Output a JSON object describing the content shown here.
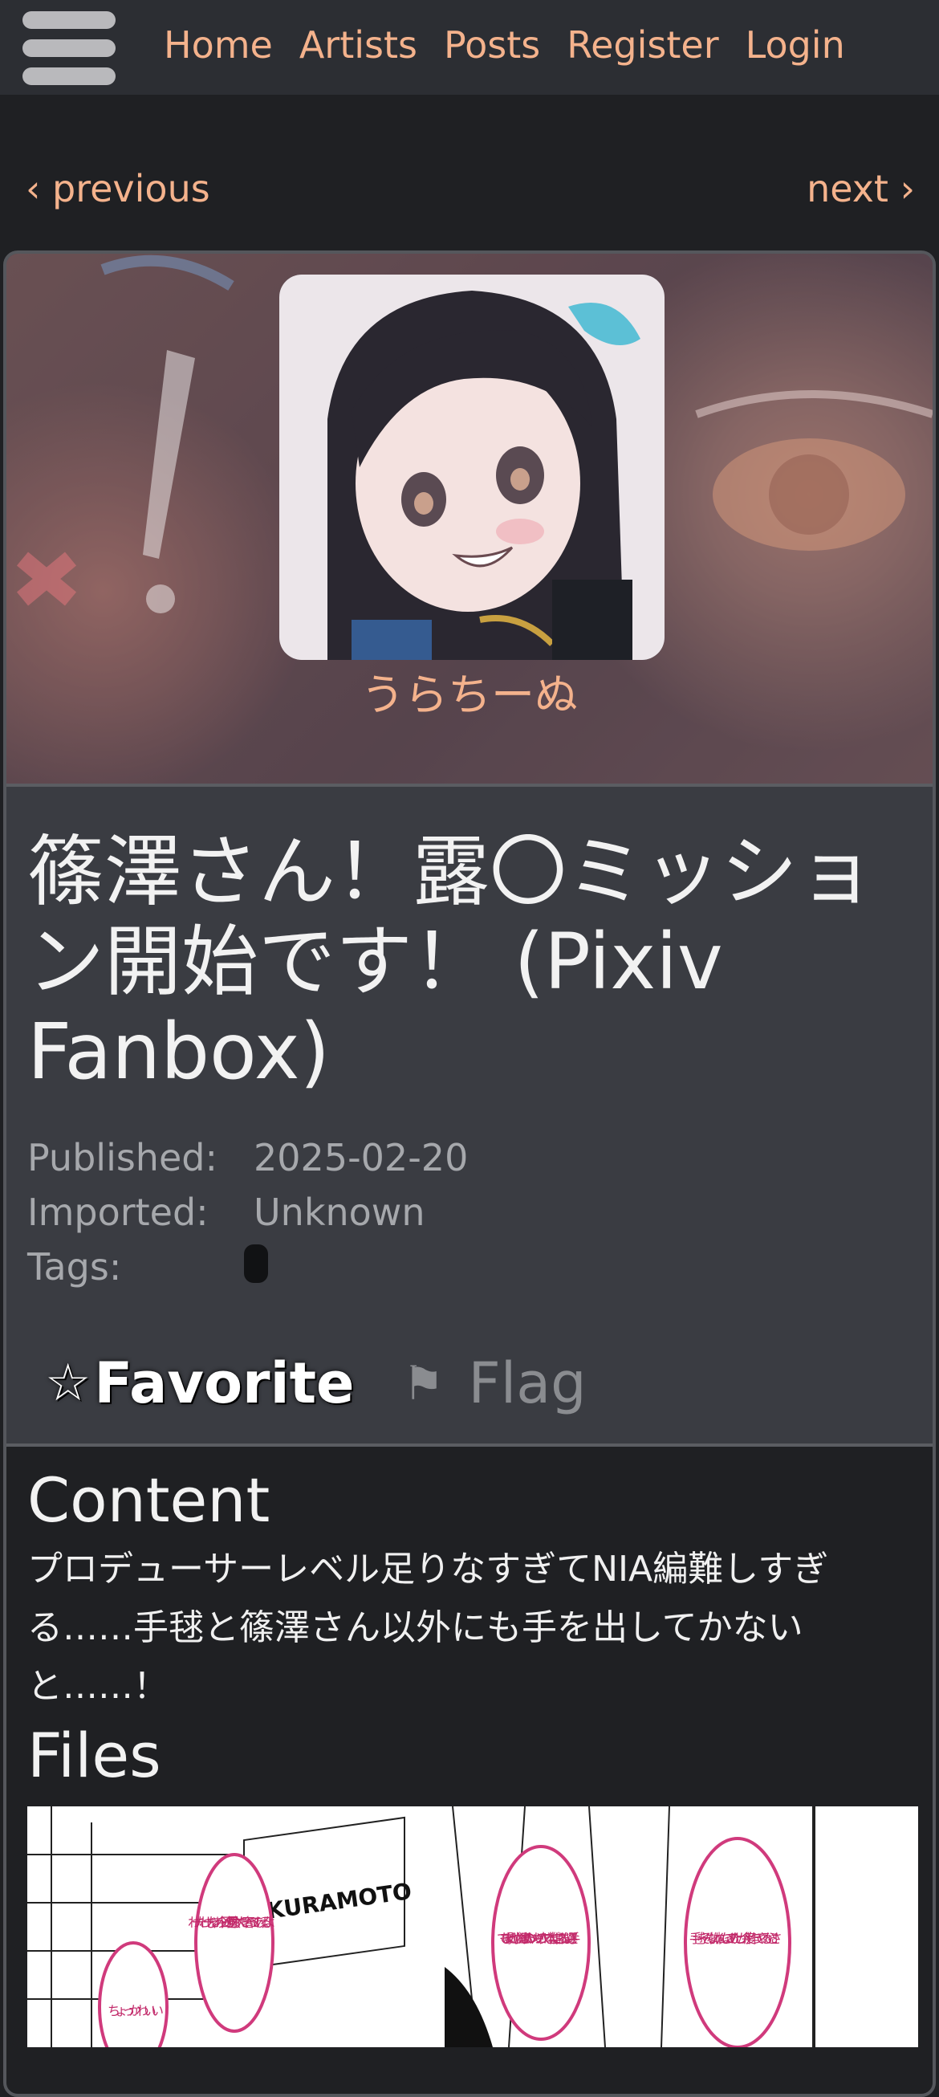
{
  "nav": {
    "links": [
      "Home",
      "Artists",
      "Posts",
      "Register",
      "Login"
    ]
  },
  "pagination": {
    "previous": "‹ previous",
    "next": "next ›"
  },
  "artist": {
    "name": "うらちーぬ"
  },
  "post": {
    "title": "篠澤さん！露〇ミッション開始です！ (Pixiv Fanbox)",
    "published_label": "Published:",
    "published_value": "2025-02-20",
    "imported_label": "Imported:",
    "imported_value": "Unknown",
    "tags_label": "Tags:",
    "favorite_star": "☆",
    "favorite_label": "Favorite",
    "flag_icon": "⚑",
    "flag_label": "Flag"
  },
  "content": {
    "heading": "Content",
    "text": "プロデューサーレベル足りなすぎてNIA編難しすぎる……手毬と篠澤さん以外にも手を出してかないと……！",
    "files_heading": "Files",
    "file_sign": "KURAMOTO",
    "bubbles": [
      "わーたわーた じゃあ今日の昼 何食べたい？ 奢ってあげるよ",
      "ちょっ かわいい",
      "でもまた剥がしたんだよ！！ 私のトンカツの衣！！本当に信じられない選手！！",
      "手毬ーそんな拗ねんなって！ あたしが今度作ってやるからさ！"
    ]
  },
  "colors": {
    "accent": "#f4b28c",
    "nav_bg": "#2c2e33",
    "page_bg": "#1f2023",
    "card_bg": "#3a3c42"
  }
}
